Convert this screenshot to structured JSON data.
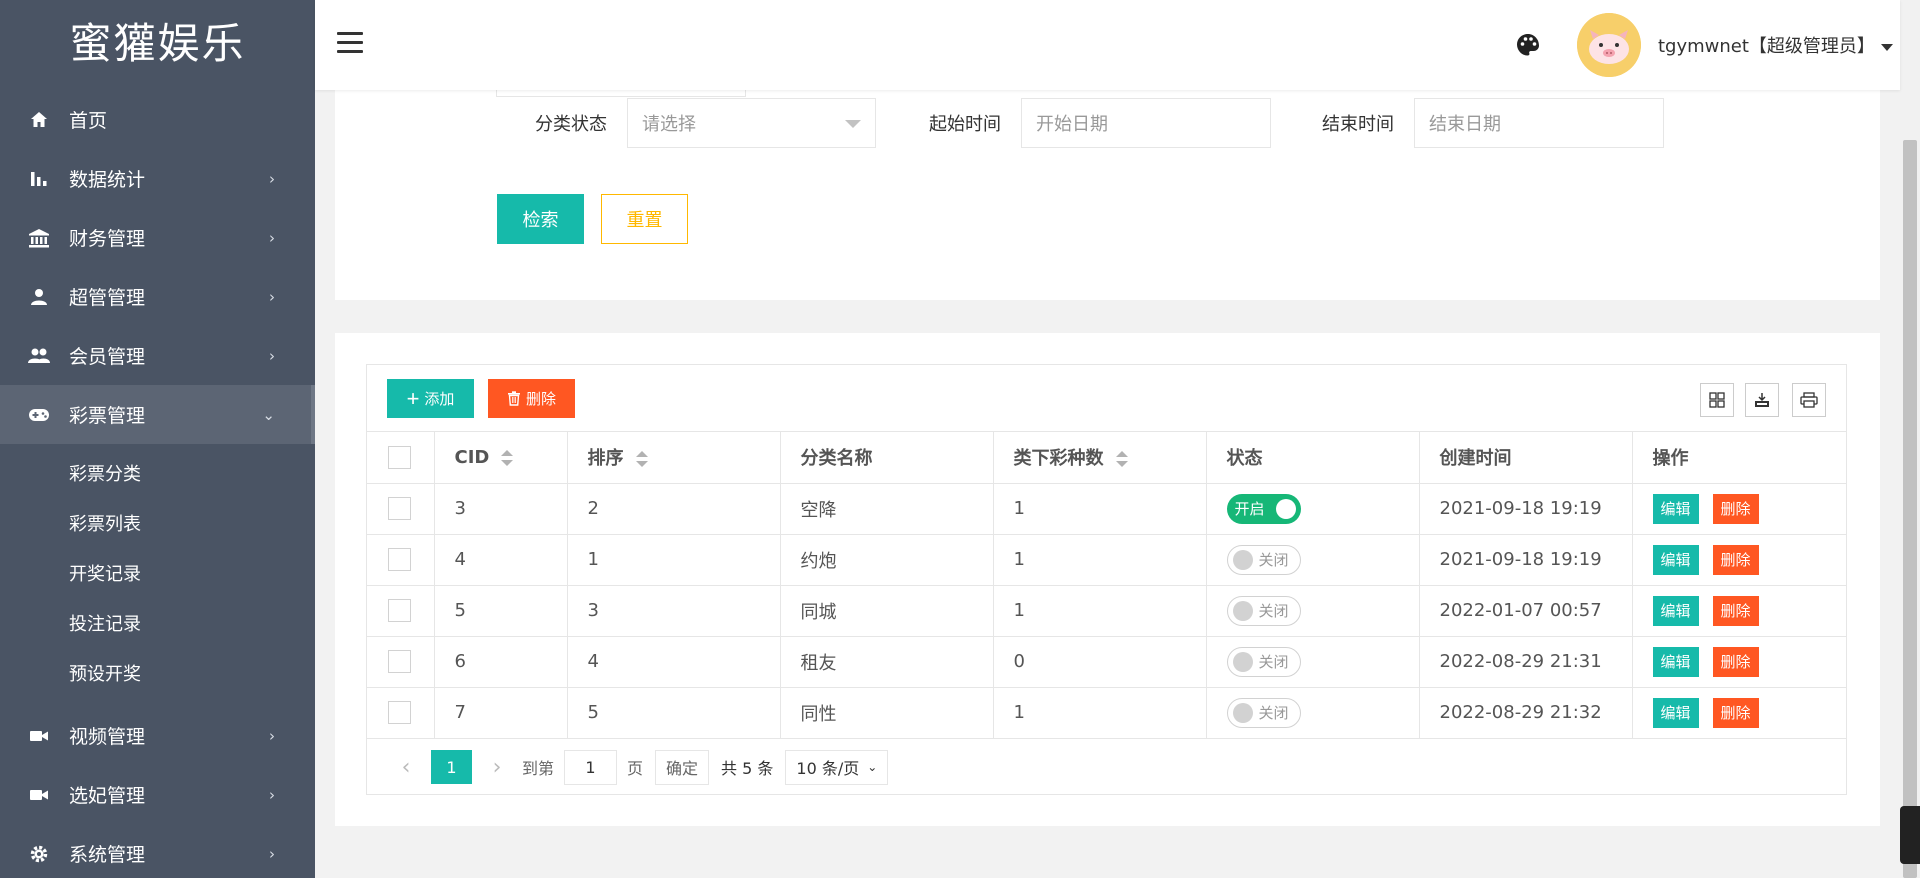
{
  "brand": {
    "title": "蜜獾娱乐"
  },
  "sidebar": {
    "items": [
      {
        "label": "首页",
        "icon": "home-icon",
        "chevron": ""
      },
      {
        "label": "数据统计",
        "icon": "bar-chart-icon",
        "chevron": "›"
      },
      {
        "label": "财务管理",
        "icon": "bank-icon",
        "chevron": "›"
      },
      {
        "label": "超管管理",
        "icon": "user-icon",
        "chevron": "›"
      },
      {
        "label": "会员管理",
        "icon": "group-icon",
        "chevron": "›"
      },
      {
        "label": "彩票管理",
        "icon": "gamepad-icon",
        "chevron": "⌄"
      },
      {
        "label": "视频管理",
        "icon": "video-icon",
        "chevron": "›"
      },
      {
        "label": "选妃管理",
        "icon": "video-icon",
        "chevron": "›"
      },
      {
        "label": "系统管理",
        "icon": "gear-icon",
        "chevron": "›"
      }
    ],
    "subitems": [
      {
        "label": "彩票分类"
      },
      {
        "label": "彩票列表"
      },
      {
        "label": "开奖记录"
      },
      {
        "label": "投注记录"
      },
      {
        "label": "预设开奖"
      }
    ]
  },
  "header": {
    "user": "tgymwnet【超级管理员】"
  },
  "search": {
    "status_label": "分类状态",
    "status_placeholder": "请选择",
    "start_label": "起始时间",
    "start_placeholder": "开始日期",
    "end_label": "结束时间",
    "end_placeholder": "结束日期",
    "search_button": "检索",
    "reset_button": "重置"
  },
  "toolbar": {
    "add_label": "添加",
    "delete_label": "删除"
  },
  "table": {
    "headers": [
      "CID",
      "排序",
      "分类名称",
      "类下彩种数",
      "状态",
      "创建时间",
      "操作"
    ],
    "rows": [
      {
        "cid": "3",
        "sort": "2",
        "name": "空降",
        "count": "1",
        "status": "开启",
        "on": true,
        "created": "2021-09-18 19:19"
      },
      {
        "cid": "4",
        "sort": "1",
        "name": "约炮",
        "count": "1",
        "status": "关闭",
        "on": false,
        "created": "2021-09-18 19:19"
      },
      {
        "cid": "5",
        "sort": "3",
        "name": "同城",
        "count": "1",
        "status": "关闭",
        "on": false,
        "created": "2022-01-07 00:57"
      },
      {
        "cid": "6",
        "sort": "4",
        "name": "租友",
        "count": "0",
        "status": "关闭",
        "on": false,
        "created": "2022-08-29 21:31"
      },
      {
        "cid": "7",
        "sort": "5",
        "name": "同性",
        "count": "1",
        "status": "关闭",
        "on": false,
        "created": "2022-08-29 21:32"
      }
    ],
    "edit_label": "编辑",
    "delete_label": "删除"
  },
  "pager": {
    "current_page": "1",
    "goto_label": "到第",
    "goto_value": "1",
    "page_unit": "页",
    "confirm_label": "确定",
    "total_text": "共 5 条",
    "per_page": "10 条/页"
  },
  "colors": {
    "sidebar_bg": "#4a5464",
    "primary": "#16baaa",
    "danger": "#ff5722",
    "warning": "#ffb800",
    "switch_on": "#16b777"
  }
}
